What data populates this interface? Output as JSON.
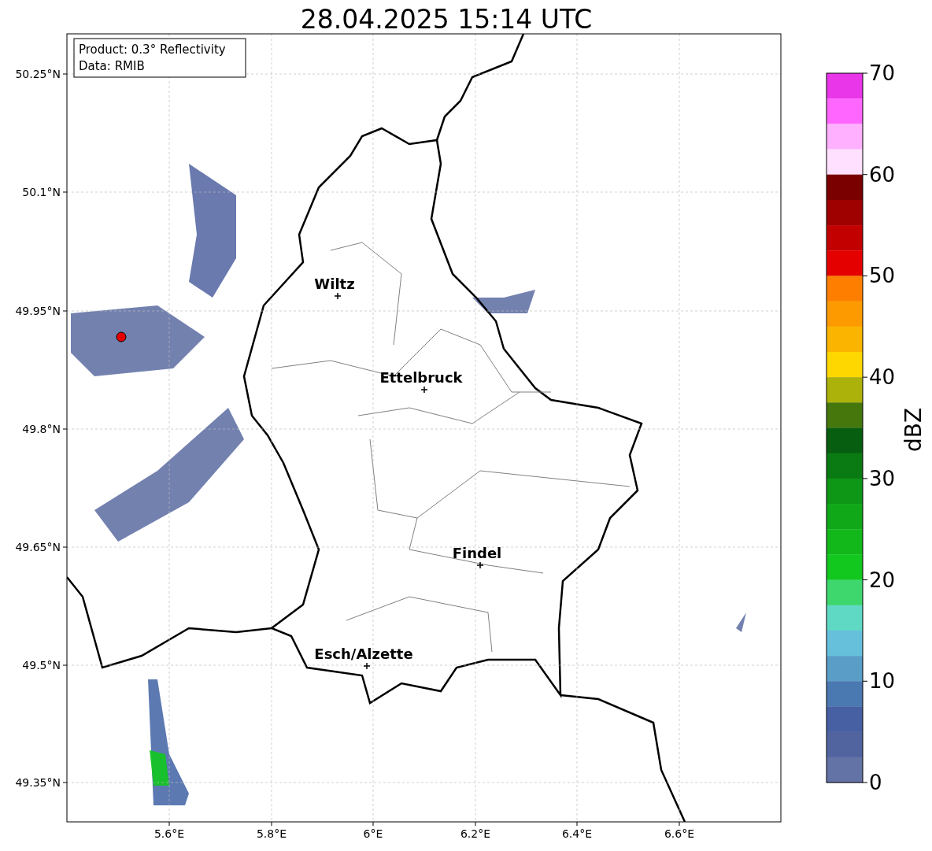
{
  "title": "28.04.2025 15:14 UTC",
  "legend": [
    "Product: 0.3° Reflectivity",
    "Data: RMIB"
  ],
  "cities": [
    {
      "name": "Wiltz"
    },
    {
      "name": "Ettelbruck"
    },
    {
      "name": "Findel"
    },
    {
      "name": "Esch/Alzette"
    }
  ],
  "x_ticks": [
    "5.6°E",
    "5.8°E",
    "6°E",
    "6.2°E",
    "6.4°E",
    "6.6°E"
  ],
  "y_ticks": [
    "50.25°N",
    "50.1°N",
    "49.95°N",
    "49.8°N",
    "49.65°N",
    "49.5°N",
    "49.35°N"
  ],
  "colorbar": {
    "label": "dBZ",
    "ticks": [
      "70",
      "60",
      "50",
      "40",
      "30",
      "20",
      "10",
      "0"
    ],
    "segments": [
      {
        "color": "#e836e8"
      },
      {
        "color": "#ff66ff"
      },
      {
        "color": "#ffb1ff"
      },
      {
        "color": "#ffe0ff"
      },
      {
        "color": "#7a0000"
      },
      {
        "color": "#9f0000"
      },
      {
        "color": "#c30000"
      },
      {
        "color": "#e50000"
      },
      {
        "color": "#fe7f00"
      },
      {
        "color": "#fd9a00"
      },
      {
        "color": "#fbb500"
      },
      {
        "color": "#ffd700"
      },
      {
        "color": "#acb20a"
      },
      {
        "color": "#45770d"
      },
      {
        "color": "#075e10"
      },
      {
        "color": "#0a7a12"
      },
      {
        "color": "#0e9616"
      },
      {
        "color": "#10a818"
      },
      {
        "color": "#12b81a"
      },
      {
        "color": "#12c81e"
      },
      {
        "color": "#3ed76e"
      },
      {
        "color": "#60d9c4"
      },
      {
        "color": "#66c0dc"
      },
      {
        "color": "#5a9ec8"
      },
      {
        "color": "#4a78b0"
      },
      {
        "color": "#4660a3"
      },
      {
        "color": "#5164a0"
      },
      {
        "color": "#6473a6"
      }
    ]
  }
}
